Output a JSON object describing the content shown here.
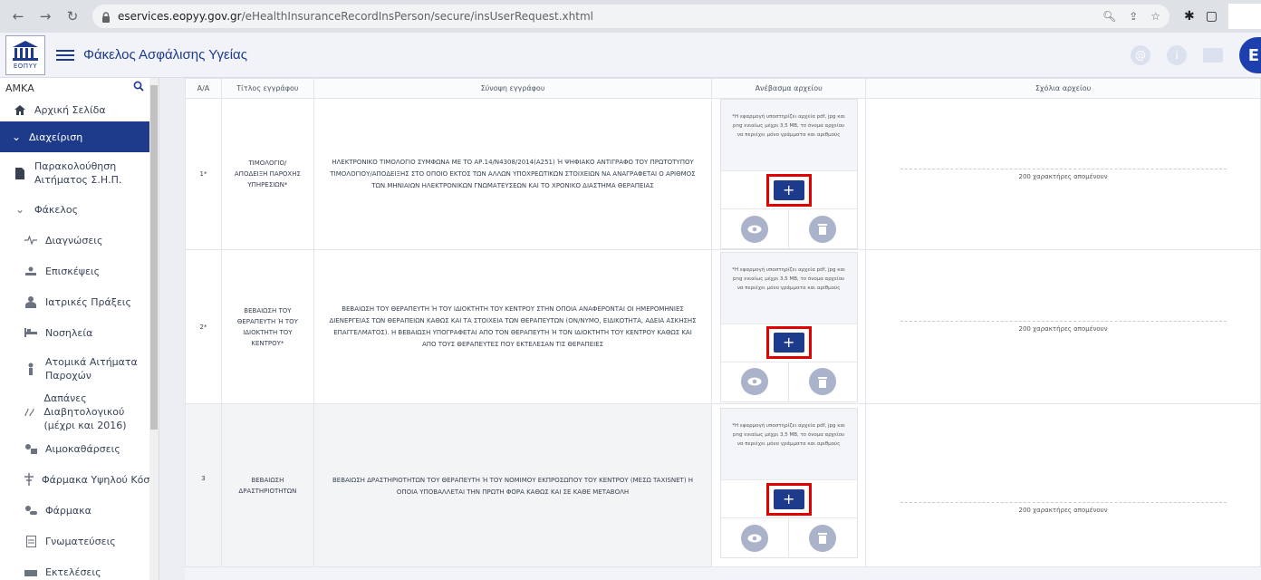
{
  "browser": {
    "url_host": "eservices.eopyy.gov.gr",
    "url_path": "/eHealthInsuranceRecordInsPerson/secure/insUserRequest.xhtml"
  },
  "header": {
    "logo_text": "ΕΟΠΥΥ",
    "title": "Φάκελος Ασφάλισης Υγείας",
    "user_initial": "Ε"
  },
  "sidebar": {
    "amka_label": "ΑΜΚΑ",
    "home": "Αρχική Σελίδα",
    "management": "Διαχείριση",
    "items": [
      {
        "label1": "Παρακολούθηση",
        "label2": "Αιτήματος Σ.Η.Π."
      },
      {
        "label1": "Φάκελος",
        "label2": ""
      },
      {
        "label1": "Διαγνώσεις",
        "label2": ""
      },
      {
        "label1": "Επισκέψεις",
        "label2": ""
      },
      {
        "label1": "Ιατρικές Πράξεις",
        "label2": ""
      },
      {
        "label1": "Νοσηλεία",
        "label2": ""
      },
      {
        "label1": "Ατομικά Αιτήματα",
        "label2": "Παροχών"
      },
      {
        "label1": "Δαπάνες Διαβητολογικού",
        "label2": "(μέχρι και 2016)"
      },
      {
        "label1": "Αιμοκαθάρσεις",
        "label2": ""
      },
      {
        "label1": "Φάρμακα Υψηλού Κόστους",
        "label2": ""
      },
      {
        "label1": "Φάρμακα",
        "label2": ""
      },
      {
        "label1": "Γνωματεύσεις",
        "label2": ""
      },
      {
        "label1": "Εκτελέσεις",
        "label2": ""
      }
    ]
  },
  "table": {
    "headers": {
      "aa": "Α/Α",
      "title": "Τίτλος εγγράφου",
      "synopsis": "Σύνοψη εγγράφου",
      "upload": "Ανέβασμα αρχείου",
      "comments": "Σχόλια αρχείου"
    },
    "upload_note": "*Η εφαρμογή υποστηρίζει αρχεία pdf, jpg και png ενιαίως μέχρι 3,5 MB, το όνομα αρχείου να περιέχει μόνο γράμματα και αριθμούς",
    "plus_label": "+",
    "comment_placeholder": "200 χαρακτήρες απομένουν",
    "rows": [
      {
        "aa": "1*",
        "title_l1": "ΤΙΜΟΛΟΓΙΟ/",
        "title_l2": "ΑΠΟΔΕΙΞΗ ΠΑΡΟΧΗΣ",
        "title_l3": "ΥΠΗΡΕΣΙΩΝ*",
        "title_l4": "",
        "synopsis": "ΗΛΕΚΤΡΟΝΙΚΟ ΤΙΜΟΛΟΓΙΟ ΣΥΜΦΩΝΑ ΜΕ ΤΟ ΑΡ.14/Ν4308/2014(Α251) Ή ΨΗΦΙΑΚΟ ΑΝΤΙΓΡΑΦΟ ΤΟΥ ΠΡΩΤΟΤΥΠΟΥ ΤΙΜΟΛΟΓΙΟΥ/ΑΠΟΔΕΙΞΗΣ ΣΤΟ ΟΠΟΙΟ ΕΚΤΟΣ ΤΩΝ ΑΛΛΩΝ ΥΠΟΧΡΕΩΤΙΚΩΝ ΣΤΟΙΧΕΙΩΝ ΝΑ ΑΝΑΓΡΑΦΕΤΑΙ Ο ΑΡΙΘΜΟΣ ΤΩΝ ΜΗΝΙΑΙΩΝ ΗΛΕΚΤΡΟΝΙΚΩΝ ΓΝΩΜΑΤΕΥΣΕΩΝ ΚΑΙ ΤΟ ΧΡΟΝΙΚΟ ΔΙΑΣΤΗΜΑ ΘΕΡΑΠΕΙΑΣ"
      },
      {
        "aa": "2*",
        "title_l1": "ΒΕΒΑΙΩΣΗ ΤΟΥ",
        "title_l2": "ΘΕΡΑΠΕΥΤΗ Ή ΤΟΥ",
        "title_l3": "ΙΔΙΟΚΤΗΤΗ ΤΟΥ",
        "title_l4": "ΚΕΝΤΡΟΥ*",
        "synopsis": "ΒΕΒΑΙΩΣΗ ΤΟΥ ΘΕΡΑΠΕΥΤΗ Ή ΤΟΥ ΙΔΙΟΚΤΗΤΗ ΤΟΥ ΚΕΝΤΡΟΥ ΣΤΗΝ ΟΠΟΙΑ ΑΝΑΦΕΡΟΝΤΑΙ ΟΙ ΗΜΕΡΟΜΗΝΙΕΣ ΔΙΕΝΕΡΓΕΙΑΣ ΤΩΝ ΘΕΡΑΠΕΙΩΝ ΚΑΘΩΣ ΚΑΙ ΤΑ ΣΤΟΙΧΕΙΑ ΤΩΝ ΘΕΡΑΠΕΥΤΩΝ (ΟΝ/ΝΥΜΟ, ΕΙΔΙΚΟΤΗΤΑ, ΑΔΕΙΑ ΑΣΚΗΣΗΣ ΕΠΑΓΓΕΛΜΑΤΟΣ). Η ΒΕΒΑΙΩΣΗ ΥΠΟΓΡΑΦΕΤΑΙ ΑΠΟ ΤΟΝ ΘΕΡΑΠΕΥΤΗ Ή ΤΟΝ ΙΔΙΟΚΤΗΤΗ ΤΟΥ ΚΕΝΤΡΟΥ ΚΑΘΩΣ ΚΑΙ ΑΠΟ ΤΟΥΣ ΘΕΡΑΠΕΥΤΕΣ ΠΟΥ ΕΚΤΕΛΕΣΑΝ ΤΙΣ ΘΕΡΑΠΕΙΕΣ"
      },
      {
        "aa": "3",
        "title_l1": "ΒΕΒΑΙΩΣΗ",
        "title_l2": "ΔΡΑΣΤΗΡΙΟΤΗΤΩΝ",
        "title_l3": "",
        "title_l4": "",
        "synopsis": "ΒΕΒΑΙΩΣΗ ΔΡΑΣΤΗΡΙΟΤΗΤΩΝ ΤΟΥ ΘΕΡΑΠΕΥΤΗ Ή ΤΟΥ ΝΟΜΙΜΟΥ ΕΚΠΡΟΣΩΠΟΥ ΤΟΥ ΚΕΝΤΡΟΥ (ΜΕΣΩ TAXISNET) Η ΟΠΟΙΑ ΥΠΟΒΑΛΛΕΤΑΙ ΤΗΝ ΠΡΩΤΗ ΦΟΡΑ ΚΑΘΩΣ ΚΑΙ ΣΕ ΚΑΘΕ ΜΕΤΑΒΟΛΗ"
      }
    ]
  }
}
